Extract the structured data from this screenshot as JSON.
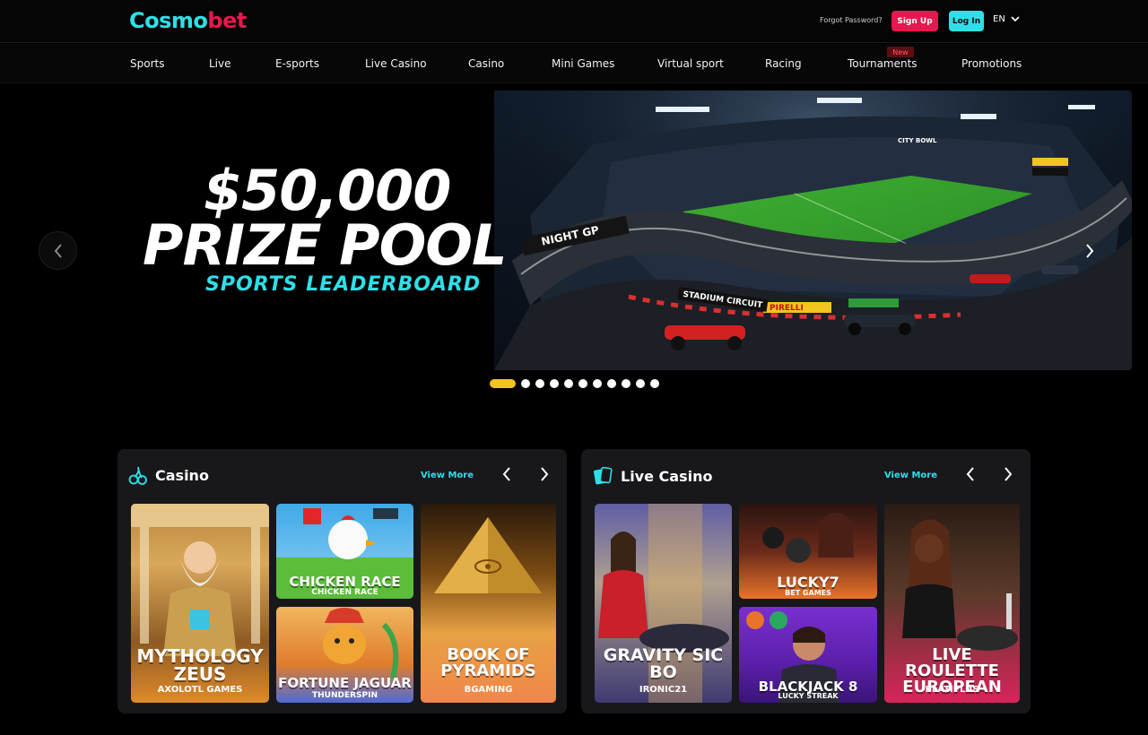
{
  "header": {
    "logo": {
      "part1": "Cosmo",
      "part2": "bet"
    },
    "forgot_password": "Forgot Password?",
    "sign_up": "Sign Up",
    "log_in": "Log In",
    "language": "EN"
  },
  "nav": {
    "items": [
      "Sports",
      "Live",
      "E-sports",
      "Live Casino",
      "Casino",
      "Mini Games",
      "Virtual sport",
      "Racing",
      "Tournaments",
      "Promotions"
    ],
    "new_badge": "New"
  },
  "banner": {
    "title_line1": "$50,000",
    "title_line2": "PRIZE POOL",
    "subtitle": "SPORTS LEADERBOARD",
    "track_sign": "NIGHT GP",
    "circuit_sign": "STADIUM CIRCUIT",
    "sponsor": "PIRELLI",
    "stadium_name": "CITY BOWL",
    "slide_count": 11,
    "active_slide": 1
  },
  "casino": {
    "title": "Casino",
    "view_more": "View More",
    "games": [
      {
        "title": "MYTHOLOGY ZEUS",
        "provider": "AXOLOTL GAMES"
      },
      {
        "title": "CHICKEN RACE",
        "provider": "CHICKEN RACE"
      },
      {
        "title": "FORTUNE JAGUAR",
        "provider": "THUNDERSPIN"
      },
      {
        "title": "BOOK OF PYRAMIDS",
        "provider": "BGAMING"
      }
    ]
  },
  "live_casino": {
    "title": "Live Casino",
    "view_more": "View More",
    "games": [
      {
        "title": "GRAVITY SIC BO",
        "provider": "IRONIC21"
      },
      {
        "title": "LUCKY7",
        "provider": "BET GAMES"
      },
      {
        "title": "BLACKJACK 8",
        "provider": "LUCKY STREAK"
      },
      {
        "title": "LIVE ROULETTE EUROPEAN",
        "provider": "PLATIPLUS"
      }
    ]
  },
  "colors": {
    "accent_cyan": "#2de0e8",
    "accent_red": "#e8174f",
    "active_dot": "#f2c51e",
    "panel_bg": "#18181b"
  }
}
